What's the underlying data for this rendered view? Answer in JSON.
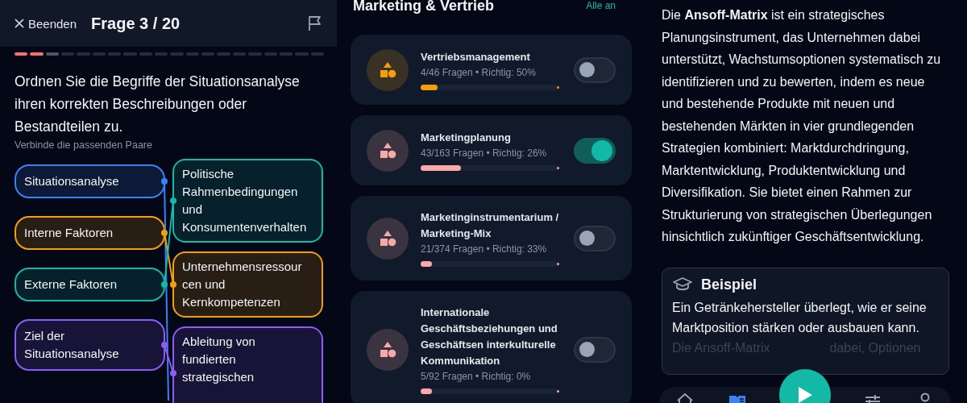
{
  "quiz": {
    "exit_label": "Beenden",
    "title": "Frage 3 / 20",
    "progress": [
      {
        "done": true,
        "current": false
      },
      {
        "done": true,
        "current": false
      },
      {
        "done": false,
        "current": true
      },
      {
        "done": false,
        "current": false
      },
      {
        "done": false,
        "current": false
      },
      {
        "done": false,
        "current": false
      },
      {
        "done": false,
        "current": false
      },
      {
        "done": false,
        "current": false
      },
      {
        "done": false,
        "current": false
      },
      {
        "done": false,
        "current": false
      },
      {
        "done": false,
        "current": false
      },
      {
        "done": false,
        "current": false
      },
      {
        "done": false,
        "current": false
      },
      {
        "done": false,
        "current": false
      },
      {
        "done": false,
        "current": false
      },
      {
        "done": false,
        "current": false
      },
      {
        "done": false,
        "current": false
      },
      {
        "done": false,
        "current": false
      },
      {
        "done": false,
        "current": false
      },
      {
        "done": false,
        "current": false
      }
    ],
    "question": "Ordnen Sie die Begriffe der Situationsanalyse ihren korrekten Beschreibungen oder Bestandteilen zu.",
    "hint": "Verbinde die passenden Paare",
    "terms": [
      {
        "text": "Situationsanalyse",
        "color": "#3b82f6"
      },
      {
        "text": "Interne Faktoren",
        "color": "#f59e0b"
      },
      {
        "text": "Externe Faktoren",
        "color": "#14b8a6"
      },
      {
        "text": "Ziel der Situationsanalyse",
        "color": "#8b5cf6"
      }
    ],
    "descriptions": [
      {
        "text": "Politische Rahmenbedingungen und Konsumentenverhalten",
        "color": "#14b8a6"
      },
      {
        "text": "Unternehmensressourcen und Kernkompetenzen",
        "color": "#f59e0b"
      },
      {
        "text": "Ableitung von fundierten strategischen",
        "color": "#8b5cf6"
      }
    ]
  },
  "topics": {
    "title": "Marketing & Vertrieb",
    "all_on_label": "Alle an",
    "items": [
      {
        "name": "Vertriebsmanagement",
        "stats": "4/46 Fragen • Richtig: 50%",
        "level": 0.12,
        "color": "#f59e0b",
        "on": false
      },
      {
        "name": "Marketingplanung",
        "stats": "43/163 Fragen • Richtig: 26%",
        "level": 0.29,
        "color": "#f9a8a8",
        "on": true
      },
      {
        "name": "Marketinginstrumentarium / Marketing-Mix",
        "stats": "21/374 Fragen • Richtig: 33%",
        "level": 0.07,
        "color": "#f9a8a8",
        "on": false
      },
      {
        "name": "Internationale Geschäftsbeziehungen und Geschäftsen interkulturelle Kommunikation",
        "stats": "5/92 Fragen • Richtig: 0%",
        "level": 0.07,
        "color": "#f9a8a8",
        "on": false
      }
    ]
  },
  "explanation": {
    "text": "Die **Ansoff-Matrix** ist ein strategisches Planungsinstrument, das Unternehmen dabei unterstützt, Wachstumsoptionen systematisch zu identifizieren und zu bewerten, indem es neue und bestehende Produkte mit neuen und bestehenden Märkten in vier grundlegenden Strategien kombiniert: Marktdurchdringung, Marktentwicklung, Produktentwicklung und Diversifikation. Sie bietet einen Rahmen zur Strukturierung von strategischen Überlegungen hinsichtlich zukünftiger Geschäftsentwicklung.",
    "example": {
      "title": "Beispiel",
      "text": "Ein Getränkehersteller überlegt, wie er seine Marktposition stärken oder ausbauen kann.",
      "faded_parts": [
        "Die Ansoff-Matrix",
        "dabei, Optionen"
      ]
    },
    "nav": [
      {
        "kind": "home",
        "selected": false
      },
      {
        "kind": "book",
        "selected": true
      },
      {
        "kind": "play",
        "selected": false
      },
      {
        "kind": "sliders",
        "selected": false
      },
      {
        "kind": "person",
        "selected": false
      }
    ]
  }
}
